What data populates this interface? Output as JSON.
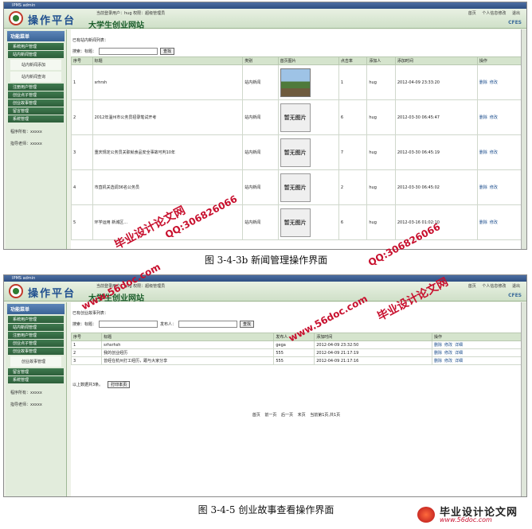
{
  "shot1": {
    "window_title": "IPMS admin",
    "app_name": "操作平台",
    "user_info": "当前登录用户：hug 权限：超级管理员",
    "site_title": "大学生创业网站",
    "nav": {
      "home": "首页",
      "profile": "个人信息修改",
      "logout": "退出"
    },
    "cfes": "CFES",
    "sidebar": {
      "head": "功能菜单",
      "items": [
        "系统用户管理",
        "站内新闻管理"
      ],
      "subs": [
        "站内新闻添加",
        "站内新闻查询"
      ],
      "items2": [
        "注册用户管理",
        "创业点子管理",
        "创业故事管理",
        "留言管理",
        "系统管理"
      ],
      "info": [
        "程序所有：xxxxx",
        "指导老师：xxxxx"
      ]
    },
    "list_caption": "已有站内新闻列表：",
    "search_label": "搜索：标题：",
    "search_button": "查找",
    "headers": [
      "序号",
      "标题",
      "类别",
      "首页图片",
      "点击率",
      "添加人",
      "添加时间",
      "操作"
    ],
    "rows": [
      {
        "no": "1",
        "title": "srhrsh",
        "cat": "站内新闻",
        "img": "photo",
        "clicks": "1",
        "user": "hug",
        "time": "2012-04-09 23:33:20"
      },
      {
        "no": "2",
        "title": "2012年温州市公务员招录笔试开考",
        "cat": "站内新闻",
        "img": "none",
        "clicks": "6",
        "user": "hug",
        "time": "2012-03-30 06:45:47"
      },
      {
        "no": "3",
        "title": "重庆规定公务员关职就食品安全事故可判10年",
        "cat": "站内新闻",
        "img": "none",
        "clicks": "7",
        "user": "hug",
        "time": "2012-03-30 06:45:19"
      },
      {
        "no": "4",
        "title": "市直机关选调36名公务员",
        "cat": "站内新闻",
        "img": "none",
        "clicks": "2",
        "user": "hug",
        "time": "2012-03-30 06:45:02"
      },
      {
        "no": "5",
        "title": "环学运用 新城区…",
        "cat": "站内新闻",
        "img": "none",
        "clicks": "6",
        "user": "hug",
        "time": "2012-03-16 01:02:10"
      }
    ],
    "no_image_text": "暂无图片",
    "ops": [
      "删除",
      "修改"
    ]
  },
  "caption1": "图 3-4-3b  新闻管理操作界面",
  "shot2": {
    "window_title": "IPMS admin",
    "app_name": "操作平台",
    "user_info": "当前登录用户：hug 权限：超级管理员",
    "site_title": "大学生创业网站",
    "nav": {
      "home": "首页",
      "profile": "个人信息修改",
      "logout": "退出"
    },
    "cfes": "CFES",
    "sidebar": {
      "head": "功能菜单",
      "items": [
        "系统用户管理",
        "站内新闻管理",
        "注册用户管理",
        "创业点子管理",
        "创业故事管理"
      ],
      "subs": [
        "创业故事管理"
      ],
      "items2": [
        "留言管理",
        "系统管理"
      ],
      "info": [
        "程序所有：xxxxx",
        "指导老师：xxxxx"
      ]
    },
    "list_caption": "已有创业故事列表：",
    "search_label": "搜索：标题：",
    "search_label2": "发布人：",
    "search_button": "查找",
    "headers": [
      "序号",
      "标题",
      "发布人",
      "添加时间",
      "操作"
    ],
    "rows": [
      {
        "no": "1",
        "title": "srhsrhsh",
        "user": "gega",
        "time": "2012-04-09 23:32:50"
      },
      {
        "no": "2",
        "title": "我的创业经历",
        "user": "555",
        "time": "2012-04-09 21:17:19"
      },
      {
        "no": "3",
        "title": "曾经在杭州打工经历，跟与大家分享",
        "user": "555",
        "time": "2012-04-09 21:17:16"
      }
    ],
    "ops": [
      "删除",
      "修改",
      "详细"
    ],
    "totals": "以上数据共3条。",
    "print_button": "打印本页",
    "pager": [
      "首页",
      "前一页",
      "后一页",
      "末页",
      "当前第1页,共1页"
    ]
  },
  "caption2": "图 3-4-5   创业故事查看操作界面",
  "watermarks": [
    "毕业设计论文网",
    "QQ:306826066",
    "www.56doc.com"
  ],
  "corner_logo": {
    "name": "毕业设计论文网",
    "url": "www.56doc.com"
  },
  "colors": {
    "watermark": "#c8102e",
    "header_blue": "#1f4f8f",
    "menu_green": "#2d5e3a"
  }
}
